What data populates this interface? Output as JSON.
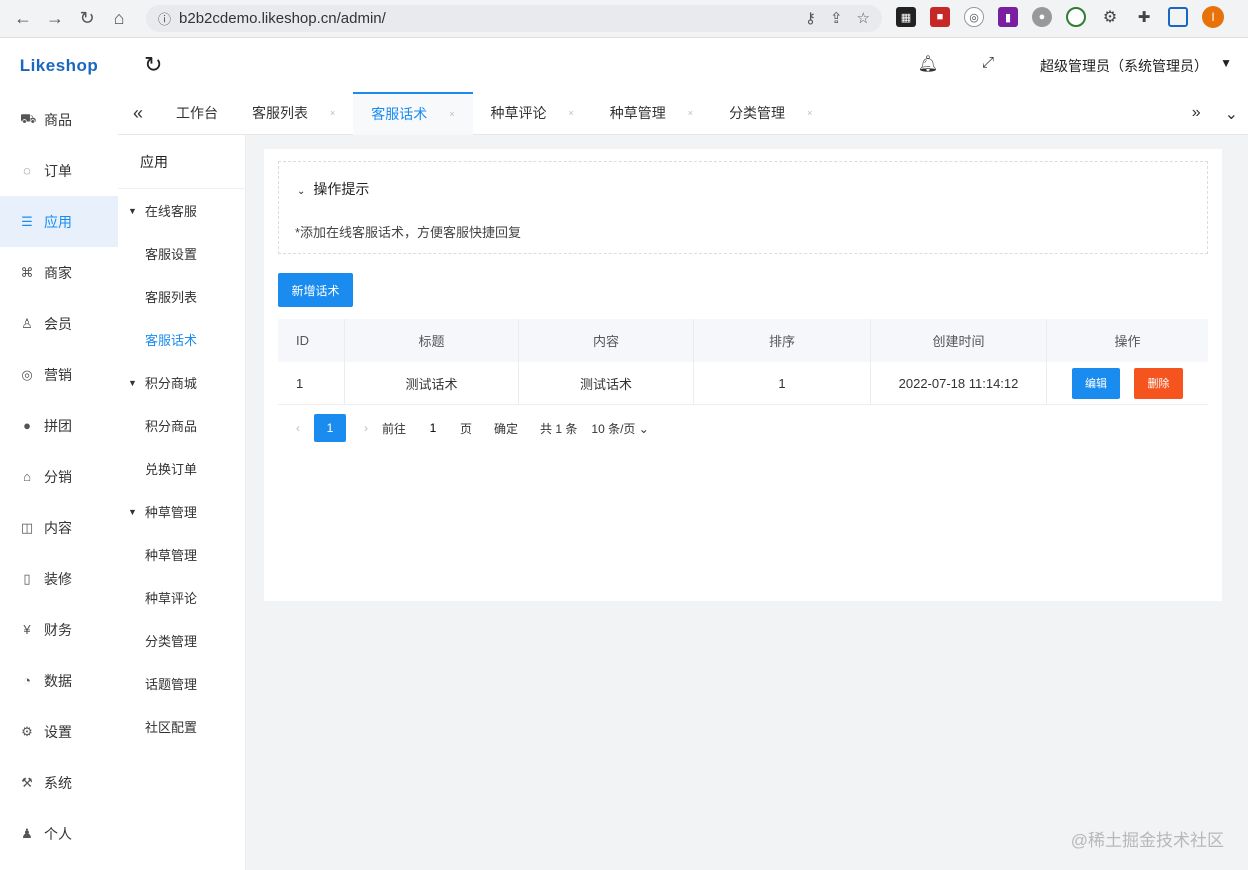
{
  "browser": {
    "url": "b2b2cdemo.likeshop.cn/admin/",
    "profile_initial": "I"
  },
  "app": {
    "logo": "Likeshop"
  },
  "sidebar": {
    "items": [
      {
        "label": "商品",
        "icon": "cart-icon"
      },
      {
        "label": "订单",
        "icon": "order-icon"
      },
      {
        "label": "应用",
        "icon": "apps-icon"
      },
      {
        "label": "商家",
        "icon": "store-icon"
      },
      {
        "label": "会员",
        "icon": "user-icon"
      },
      {
        "label": "营销",
        "icon": "marketing-icon"
      },
      {
        "label": "拼团",
        "icon": "group-icon"
      },
      {
        "label": "分销",
        "icon": "distribution-icon"
      },
      {
        "label": "内容",
        "icon": "content-icon"
      },
      {
        "label": "装修",
        "icon": "decor-icon"
      },
      {
        "label": "财务",
        "icon": "yen-icon"
      },
      {
        "label": "数据",
        "icon": "data-icon"
      },
      {
        "label": "设置",
        "icon": "settings-icon"
      },
      {
        "label": "系统",
        "icon": "system-icon"
      },
      {
        "label": "个人",
        "icon": "person-icon"
      }
    ],
    "active_index": 2
  },
  "topbar": {
    "admin_name": "超级管理员（系统管理员）"
  },
  "tabs": {
    "items": [
      "工作台",
      "客服列表",
      "客服话术",
      "种草评论",
      "种草管理",
      "分类管理"
    ],
    "active_index": 2
  },
  "subnav": {
    "title": "应用",
    "groups": [
      {
        "label": "在线客服",
        "items": [
          "客服设置",
          "客服列表",
          "客服话术"
        ]
      },
      {
        "label": "积分商城",
        "items": [
          "积分商品",
          "兑换订单"
        ]
      },
      {
        "label": "种草管理",
        "items": [
          "种草管理",
          "种草评论",
          "分类管理",
          "话题管理",
          "社区配置"
        ]
      }
    ]
  },
  "tip": {
    "title": "操作提示",
    "text": "*添加在线客服话术，方便客服快捷回复"
  },
  "add_button": "新增话术",
  "table": {
    "headers": [
      "ID",
      "标题",
      "内容",
      "排序",
      "创建时间",
      "操作"
    ],
    "rows": [
      {
        "id": "1",
        "title": "测试话术",
        "content": "测试话术",
        "sort": "1",
        "created": "2022-07-18 11:14:12"
      }
    ],
    "edit_label": "编辑",
    "delete_label": "删除"
  },
  "pager": {
    "current_page": "1",
    "goto_label": "前往",
    "goto_value": "1",
    "page_unit": "页",
    "confirm_label": "确定",
    "total_label": "共 1 条",
    "page_size": "10 条/页"
  },
  "watermark": "@稀土掘金技术社区"
}
